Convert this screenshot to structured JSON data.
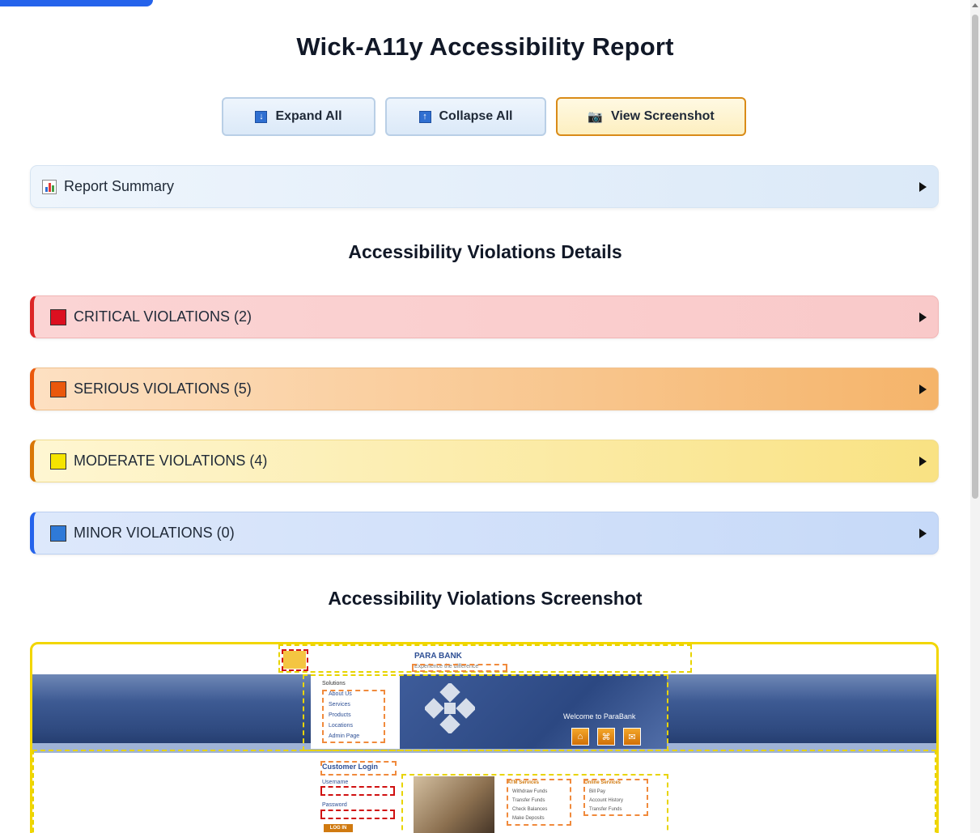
{
  "report": {
    "title": "Wick-A11y Accessibility Report",
    "buttons": {
      "expand_all": "Expand All",
      "collapse_all": "Collapse All",
      "view_screenshot": "View Screenshot"
    },
    "summary_label": "Report Summary",
    "violations_heading": "Accessibility Violations Details",
    "violations": [
      {
        "label": "CRITICAL VIOLATIONS (2)",
        "color": "#dc2626"
      },
      {
        "label": "SERIOUS VIOLATIONS (5)",
        "color": "#ea580c"
      },
      {
        "label": "MODERATE VIOLATIONS (4)",
        "color": "#facc15"
      },
      {
        "label": "MINOR VIOLATIONS (0)",
        "color": "#2f6fd1"
      }
    ],
    "screenshot_heading": "Accessibility Violations Screenshot"
  },
  "screenshot": {
    "bank_name": "PARA BANK",
    "tagline": "Experience the difference",
    "menu": [
      "Solutions",
      "About Us",
      "Services",
      "Products",
      "Locations",
      "Admin Page"
    ],
    "welcome": "Welcome to ParaBank",
    "login_title": "Customer Login",
    "username_label": "Username",
    "password_label": "Password",
    "login_button": "LOG IN",
    "atm_services": [
      "ATM Services",
      "Withdraw Funds",
      "Transfer Funds",
      "Check Balances",
      "Make Deposits"
    ],
    "online_services": [
      "Online Services",
      "Bill Pay",
      "Account History",
      "Transfer Funds"
    ]
  },
  "icons": {
    "expand": "arrow-down-icon",
    "collapse": "arrow-up-icon",
    "screenshot": "camera-icon",
    "summary": "bar-chart-icon",
    "toggle": "caret-right-icon"
  }
}
